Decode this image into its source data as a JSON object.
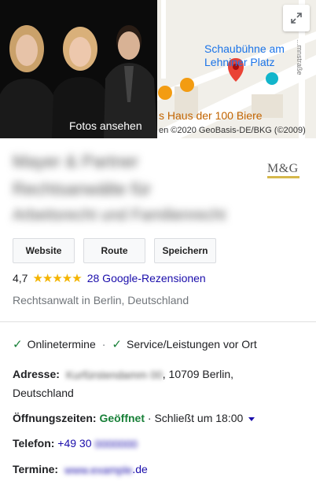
{
  "photo": {
    "caption": "Fotos ansehen"
  },
  "map": {
    "place_1": "Schaubühne am\nLehniner Platz",
    "place_2": "s Haus der 100 Biere",
    "street": "...mnstraße",
    "copyright": "en ©2020 GeoBasis-DE/BKG (©2009)",
    "expand_icon": "expand-icon"
  },
  "business": {
    "name_line_1": "Mayer & Partner",
    "name_line_2": "Rechtsanwälte für",
    "name_line_3": "Arbeitsrecht und Familienrecht",
    "logo_text": "M&G",
    "logo_color": "#d6b84c"
  },
  "actions": {
    "website": "Website",
    "route": "Route",
    "save": "Speichern"
  },
  "rating": {
    "value": "4,7",
    "stars": "★★★★★",
    "reviews": "28 Google-Rezensionen"
  },
  "category": "Rechtsanwalt in Berlin, Deutschland",
  "features": {
    "item_1": "Onlinetermine",
    "separator": "·",
    "item_2": "Service/Leistungen vor Ort"
  },
  "details": {
    "address_label": "Adresse:",
    "address_blur": "Kurfürstendamm 00",
    "address_rest": ", 10709 Berlin,",
    "address_line_2": "Deutschland",
    "hours_label": "Öffnungszeiten:",
    "hours_status": "Geöffnet",
    "hours_rest": " · Schließt um 18:00",
    "phone_label": "Telefon:",
    "phone_prefix": "+49 30",
    "phone_blur": "0000000",
    "appointments_label": "Termine:",
    "appointments_blur": "www.example",
    "appointments_suffix": ".de"
  }
}
